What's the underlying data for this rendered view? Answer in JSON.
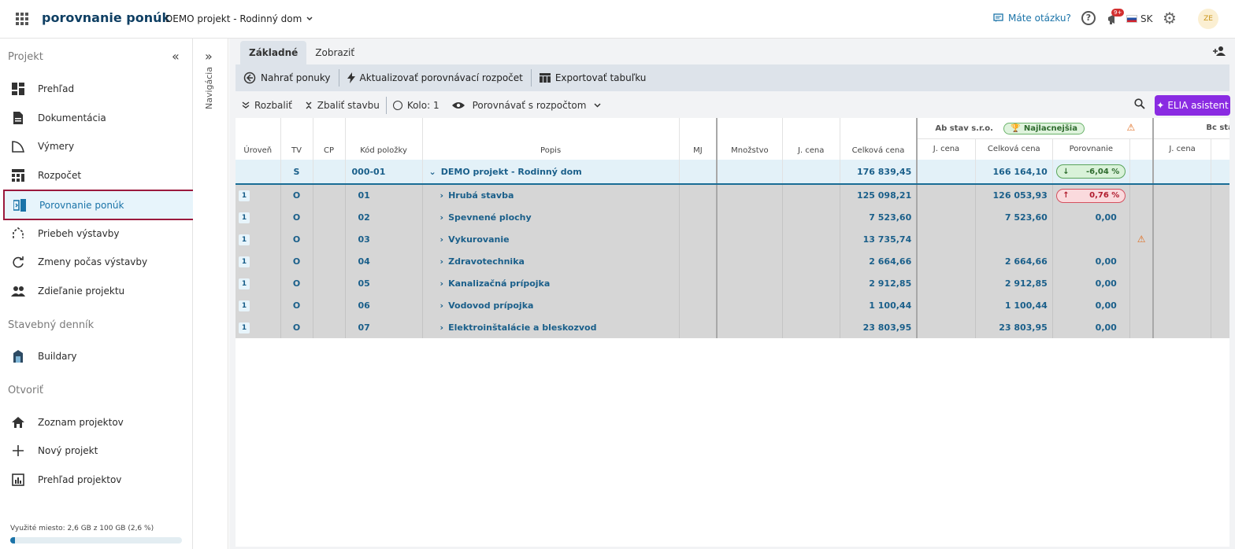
{
  "topbar": {
    "app_title": "porovnanie ponúk",
    "project": "DEMO projekt - Rodinný dom",
    "help": "Máte otázku?",
    "notifications": "9+",
    "language": "SK",
    "avatar": "ZE"
  },
  "sidebar": {
    "section_project": "Projekt",
    "items_project": [
      {
        "label": "Prehľad",
        "icon": "dashboard-icon"
      },
      {
        "label": "Dokumentácia",
        "icon": "document-icon"
      },
      {
        "label": "Výmery",
        "icon": "measure-icon"
      },
      {
        "label": "Rozpočet",
        "icon": "budget-icon"
      },
      {
        "label": "Porovnanie ponúk",
        "icon": "compare-icon"
      },
      {
        "label": "Priebeh výstavby",
        "icon": "progress-icon"
      },
      {
        "label": "Zmeny počas výstavby",
        "icon": "changes-icon"
      },
      {
        "label": "Zdieľanie projektu",
        "icon": "people-icon"
      }
    ],
    "section_diary": "Stavebný denník",
    "items_diary": [
      {
        "label": "Buildary",
        "icon": "buildary-icon"
      }
    ],
    "section_open": "Otvoriť",
    "items_open": [
      {
        "label": "Zoznam projektov",
        "icon": "home-icon"
      },
      {
        "label": "Nový projekt",
        "icon": "plus-icon"
      },
      {
        "label": "Prehľad projektov",
        "icon": "report-icon"
      }
    ],
    "storage_text": "Využité miesto: 2,6 GB z 100 GB (2,6 %)",
    "storage_fraction": 0.026
  },
  "rail": {
    "label": "Navigácia"
  },
  "tabs": [
    "Základné",
    "Zobraziť"
  ],
  "toolbar": {
    "upload": "Nahrať ponuky",
    "update": "Aktualizovať porovnávací rozpočet",
    "export": "Exportovať tabuľku"
  },
  "toolbar2": {
    "expand": "Rozbaliť",
    "collapse": "Zbaliť stavbu",
    "round": "Kolo: 1",
    "compare": "Porovnávať s rozpočtom",
    "elia": "ELIA asistent"
  },
  "table": {
    "headers": {
      "level": "Úroveň",
      "tv": "TV",
      "cp": "CP",
      "code": "Kód položky",
      "desc": "Popis",
      "mj": "MJ",
      "qty": "Množstvo",
      "unit_price": "J. cena",
      "total": "Celková cena",
      "b_unit": "J. cena",
      "b_total": "Celková cena",
      "b_compare": "Porovnanie",
      "c_unit": "J. cena"
    },
    "bidder1": "Ab stav s.r.o.",
    "bidder1_badge": "Najlacnejšia",
    "bidder2": "Bc stav",
    "root": {
      "tv": "S",
      "code": "000-01",
      "desc": "DEMO projekt - Rodinný dom",
      "total": "176 839,45",
      "b_total": "166 164,10",
      "compare": "-6,04 %"
    },
    "rows": [
      {
        "level": "1",
        "tv": "O",
        "code": "01",
        "desc": "Hrubá stavba",
        "total": "125 098,21",
        "b_total": "126 053,93",
        "compare": "0,76 %",
        "compare_kind": "up"
      },
      {
        "level": "1",
        "tv": "O",
        "code": "02",
        "desc": "Spevnené plochy",
        "total": "7 523,60",
        "b_total": "7 523,60",
        "compare": "0,00",
        "compare_kind": "plain"
      },
      {
        "level": "1",
        "tv": "O",
        "code": "03",
        "desc": "Vykurovanie",
        "total": "13 735,74",
        "b_total": "",
        "compare": "",
        "compare_kind": "warn"
      },
      {
        "level": "1",
        "tv": "O",
        "code": "04",
        "desc": "Zdravotechnika",
        "total": "2 664,66",
        "b_total": "2 664,66",
        "compare": "0,00",
        "compare_kind": "plain"
      },
      {
        "level": "1",
        "tv": "O",
        "code": "05",
        "desc": "Kanalizačná prípojka",
        "total": "2 912,85",
        "b_total": "2 912,85",
        "compare": "0,00",
        "compare_kind": "plain"
      },
      {
        "level": "1",
        "tv": "O",
        "code": "06",
        "desc": "Vodovod prípojka",
        "total": "1 100,44",
        "b_total": "1 100,44",
        "compare": "0,00",
        "compare_kind": "plain"
      },
      {
        "level": "1",
        "tv": "O",
        "code": "07",
        "desc": "Elektroinštalácie a bleskozvod",
        "total": "23 803,95",
        "b_total": "23 803,95",
        "compare": "0,00",
        "compare_kind": "plain"
      }
    ]
  },
  "colors": {
    "brand": "#0f3f63",
    "accent": "#1a73a8",
    "active_outline": "#9b1a3d",
    "elia": "#8a2be2"
  }
}
